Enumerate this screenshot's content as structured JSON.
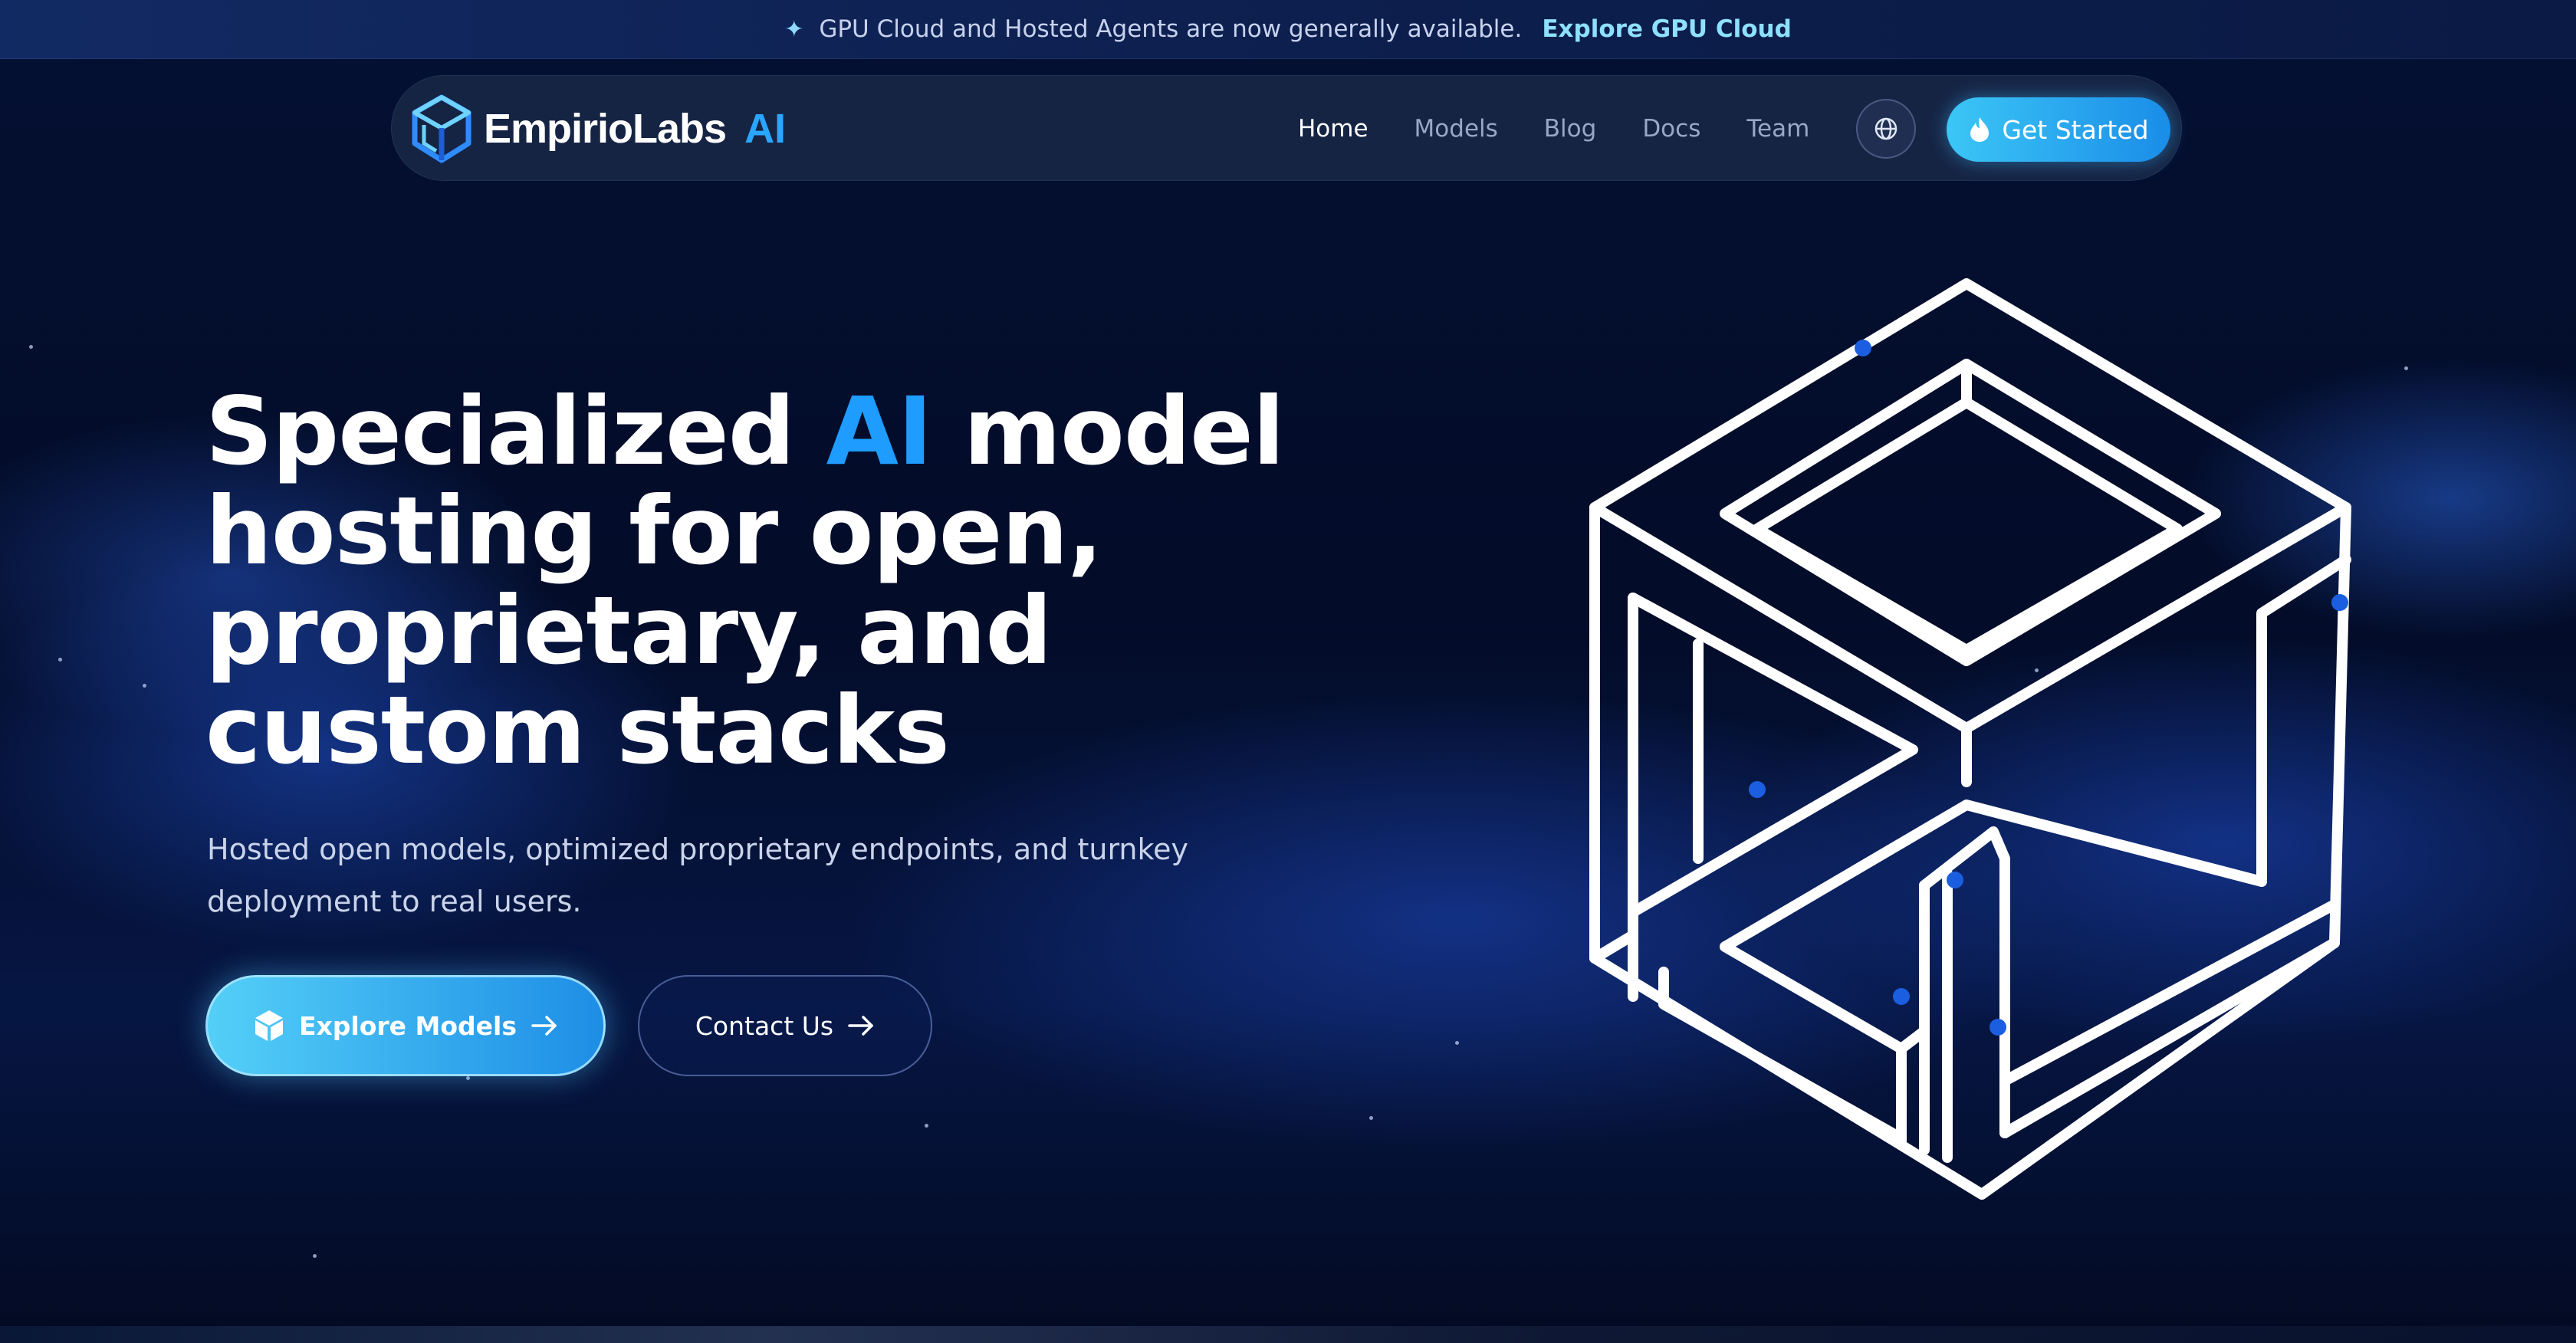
{
  "announcement": {
    "icon": "sparkle-icon",
    "text": "GPU Cloud and Hosted Agents are now generally available.",
    "link_label": "Explore GPU Cloud"
  },
  "nav": {
    "brand": "EmpirioLabs",
    "brand_suffix": "AI",
    "links": [
      {
        "label": "Home",
        "active": true
      },
      {
        "label": "Models",
        "active": false
      },
      {
        "label": "Blog",
        "active": false
      },
      {
        "label": "Docs",
        "active": false
      },
      {
        "label": "Team",
        "active": false
      }
    ],
    "language_icon": "globe-icon",
    "cta_label": "Get Started",
    "cta_icon": "flame-icon"
  },
  "hero": {
    "title_before": "Specialized ",
    "title_accent": "AI",
    "title_after": " model hosting for open, proprietary, and custom stacks",
    "subtitle": "Hosted open models, optimized proprietary endpoints, and turnkey deployment to real users.",
    "primary_button": {
      "label": "Explore Models",
      "icon": "cube-icon"
    },
    "secondary_button": {
      "label": "Contact Us"
    },
    "illustration": "isometric-cube-logo"
  },
  "colors": {
    "background": "#030d2a",
    "accent": "#1e9cff",
    "cta_start": "#3cc6f6",
    "cta_end": "#1a8de8",
    "link": "#8ee0ff"
  }
}
